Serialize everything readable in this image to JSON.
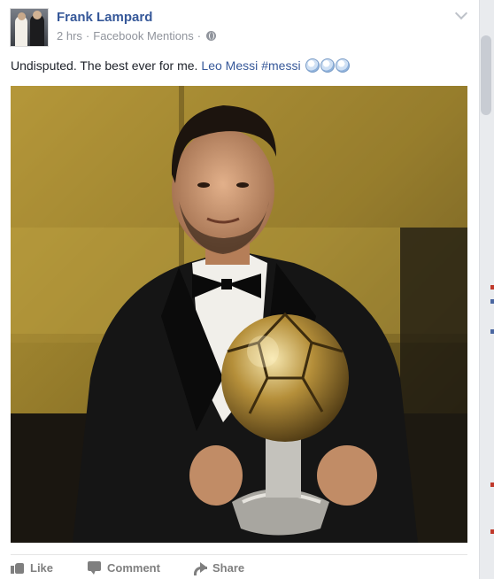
{
  "post": {
    "author": "Frank Lampard",
    "time": "2 hrs",
    "separator": "·",
    "source": "Facebook Mentions",
    "privacy_icon": "globe-icon",
    "text": {
      "plain": "Undisputed. The best ever for me.",
      "mention": "Leo Messi",
      "hashtag": "#messi",
      "emoji": [
        "ball-emoji",
        "ball-emoji",
        "ball-emoji"
      ]
    },
    "photo_icon": "photo"
  },
  "actions": {
    "like_label": "Like",
    "comment_label": "Comment",
    "share_label": "Share"
  },
  "colors": {
    "link": "#365899",
    "meta": "#90949c",
    "action": "#7f7f7f",
    "background": "#e9ebee"
  }
}
